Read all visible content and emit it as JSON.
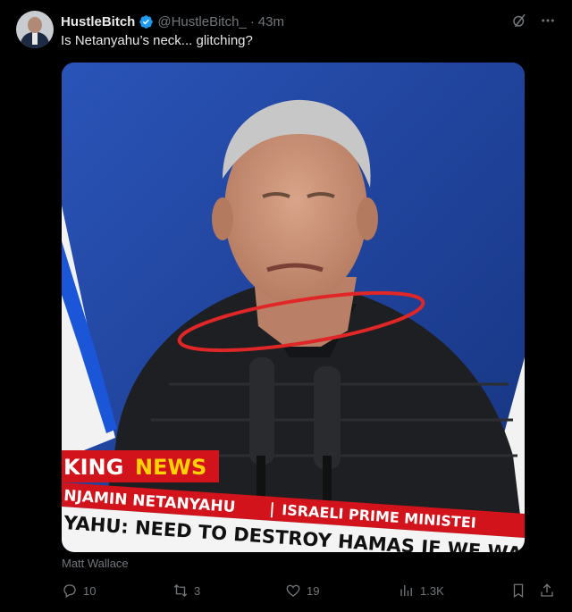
{
  "tweet": {
    "author_name": "HustleBitch",
    "handle": "@HustleBitch_",
    "separator": "·",
    "time": "43m",
    "text": "Is Netanyahu’s neck... glitching?",
    "media_credit": "Matt Wallace",
    "media_caption": {
      "banner": "KING NEWS",
      "banner_prefix": "KING",
      "banner_news": "NEWS",
      "name_line": "NJAMIN NETANYAHU",
      "title_line": "ISRAELI PRIME MINISTEI",
      "divider": "|",
      "headline": "YAHU: NEED TO DESTROY HAMAS IF WE WANT"
    }
  },
  "actions": {
    "replies": "10",
    "reposts": "3",
    "likes": "19",
    "views": "1.3K"
  },
  "icons": {
    "verified": "verified-badge-icon",
    "grok": "grok-icon",
    "more": "more-icon",
    "reply": "reply-icon",
    "repost": "repost-icon",
    "like": "heart-icon",
    "views": "views-icon",
    "bookmark": "bookmark-icon",
    "share": "share-icon"
  },
  "colors": {
    "background": "#000000",
    "text": "#e7e9ea",
    "muted": "#71767b",
    "verified": "#1d9bf0",
    "stage_blue": "#1b3e9c",
    "news_red": "#d2131b",
    "news_yellow": "#ffd200",
    "annotation_circle": "#e02626"
  }
}
